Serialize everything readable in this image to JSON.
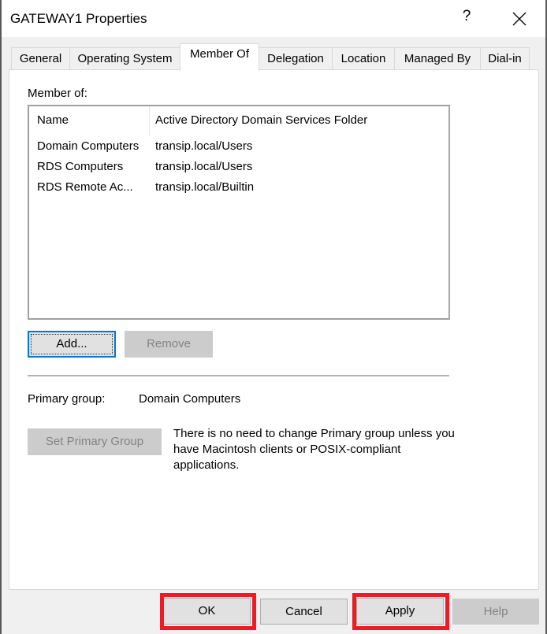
{
  "window": {
    "title": "GATEWAY1 Properties",
    "help_glyph": "?",
    "close_icon": "close-icon"
  },
  "tabs": [
    {
      "label": "General",
      "active": false
    },
    {
      "label": "Operating System",
      "active": false
    },
    {
      "label": "Member Of",
      "active": true
    },
    {
      "label": "Delegation",
      "active": false
    },
    {
      "label": "Location",
      "active": false
    },
    {
      "label": "Managed By",
      "active": false
    },
    {
      "label": "Dial-in",
      "active": false
    }
  ],
  "member_of": {
    "label": "Member of:",
    "columns": [
      "Name",
      "Active Directory Domain Services Folder"
    ],
    "rows": [
      {
        "name": "Domain Computers",
        "folder": "transip.local/Users"
      },
      {
        "name": "RDS Computers",
        "folder": "transip.local/Users"
      },
      {
        "name": "RDS Remote Ac...",
        "folder": "transip.local/Builtin"
      }
    ],
    "add_label": "Add...",
    "remove_label": "Remove"
  },
  "primary_group": {
    "label": "Primary group:",
    "value": "Domain Computers",
    "set_button_label": "Set Primary Group",
    "note": "There is no need to change Primary group unless you have Macintosh clients or POSIX-compliant applications."
  },
  "footer": {
    "ok_label": "OK",
    "cancel_label": "Cancel",
    "apply_label": "Apply",
    "help_label": "Help"
  },
  "highlight_color": "#ed1c24",
  "focus_color": "#0078d7"
}
